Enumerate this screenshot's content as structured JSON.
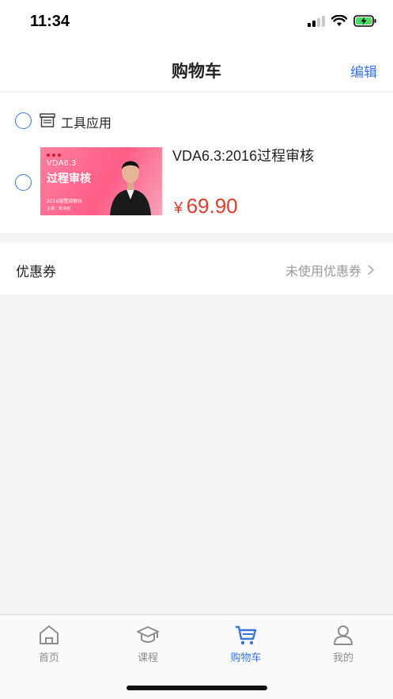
{
  "status_bar": {
    "time": "11:34"
  },
  "nav": {
    "title": "购物车",
    "edit_label": "编辑"
  },
  "shop": {
    "name": "工具应用",
    "item": {
      "title": "VDA6.3:2016过程审核",
      "thumb_line1": "VDA6.3",
      "thumb_line2": "过程审核",
      "thumb_sub": "2016版整部解析",
      "thumb_sub2": "主讲：朱书库",
      "currency": "¥",
      "price": "69.90"
    }
  },
  "coupon": {
    "label": "优惠券",
    "value": "未使用优惠券"
  },
  "tabs": [
    {
      "label": "首页",
      "icon": "home-icon"
    },
    {
      "label": "课程",
      "icon": "graduation-cap-icon"
    },
    {
      "label": "购物车",
      "icon": "cart-icon",
      "active": true
    },
    {
      "label": "我的",
      "icon": "user-icon"
    }
  ],
  "colors": {
    "accent": "#3b74d6",
    "price": "#e23b32",
    "thumb_pink": "#ff5d86"
  }
}
